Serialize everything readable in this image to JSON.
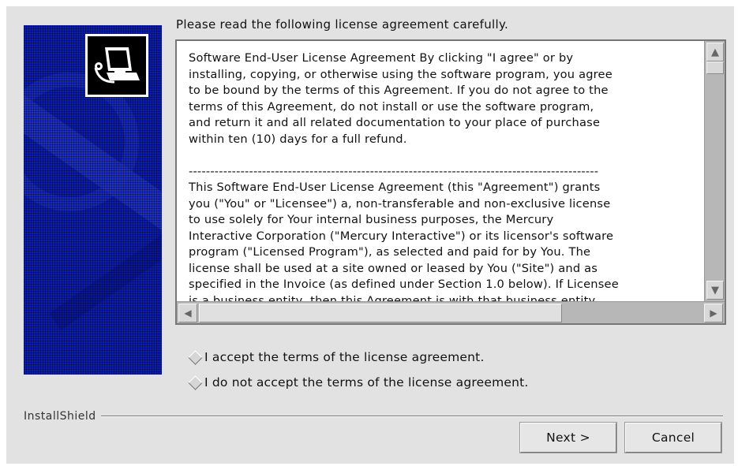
{
  "instruction": "Please read the following license agreement carefully.",
  "license": {
    "text": "Software End-User License Agreement By clicking \"I agree\" or by\ninstalling, copying, or otherwise using the software program, you agree\nto be bound by the terms of this Agreement. If you do not agree to the\nterms of this Agreement, do not install or use the software program,\nand return it and all related documentation to your place of purchase\nwithin ten (10) days for a full refund.\n\n-----------------------------------------------------------------------------------------------\nThis Software End-User License Agreement (this \"Agreement\") grants\nyou (\"You\" or \"Licensee\") a, non-transferable and non-exclusive license\nto use solely for Your internal business purposes, the Mercury\nInteractive Corporation (\"Mercury Interactive\") or its licensor's software\nprogram (\"Licensed Program\"), as selected and paid for by You. The\nlicense shall be used at a site owned or leased by You (\"Site\") and as\nspecified in the Invoice (as defined under Section 1.0 below). If Licensee\nis a business entity, then this Agreement is with that business entity."
  },
  "options": {
    "accept": "I accept the terms of the license agreement.",
    "decline": "I do not accept the terms of the license agreement."
  },
  "brand": "InstallShield",
  "buttons": {
    "next": "Next >",
    "cancel": "Cancel"
  },
  "icons": {
    "logo": "computer-install-icon",
    "scroll_up": "arrow-up-icon",
    "scroll_down": "arrow-down-icon",
    "scroll_left": "arrow-left-icon",
    "scroll_right": "arrow-right-icon"
  }
}
